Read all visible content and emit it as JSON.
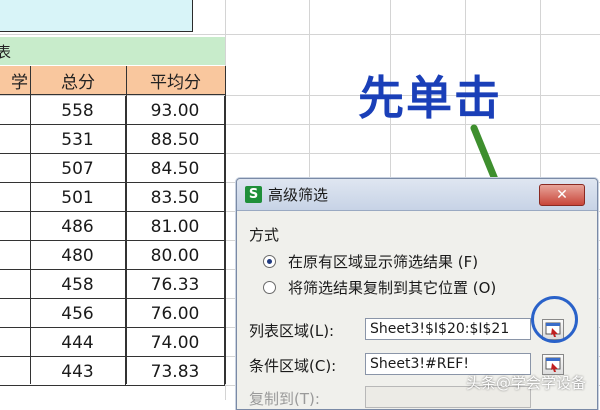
{
  "sheet": {
    "partial_title": "表",
    "headers": [
      "学",
      "总分",
      "平均分"
    ],
    "rows": [
      {
        "total": "558",
        "avg": "93.00"
      },
      {
        "total": "531",
        "avg": "88.50"
      },
      {
        "total": "507",
        "avg": "84.50"
      },
      {
        "total": "501",
        "avg": "83.50"
      },
      {
        "total": "486",
        "avg": "81.00"
      },
      {
        "total": "480",
        "avg": "80.00"
      },
      {
        "total": "458",
        "avg": "76.33"
      },
      {
        "total": "456",
        "avg": "76.00"
      },
      {
        "total": "444",
        "avg": "74.00"
      },
      {
        "total": "443",
        "avg": "73.83"
      }
    ]
  },
  "annotation": {
    "text": "先单击",
    "color": "#1a3fb8",
    "arrow_color": "#3e8f2e",
    "circle_color": "#2a62c9"
  },
  "dialog": {
    "title": "高级筛选",
    "app_icon": "S",
    "close_label": "✕",
    "mode_label": "方式",
    "option1": "在原有区域显示筛选结果 (F)",
    "option1_selected": true,
    "option2": "将筛选结果复制到其它位置 (O)",
    "list_range_label": "列表区域(L):",
    "list_range_value": "Sheet3!$I$20:$I$21",
    "criteria_label": "条件区域(C):",
    "criteria_value": "Sheet3!#REF!",
    "copy_to_label": "复制到(T):"
  },
  "watermark": "头条@学会学设备"
}
